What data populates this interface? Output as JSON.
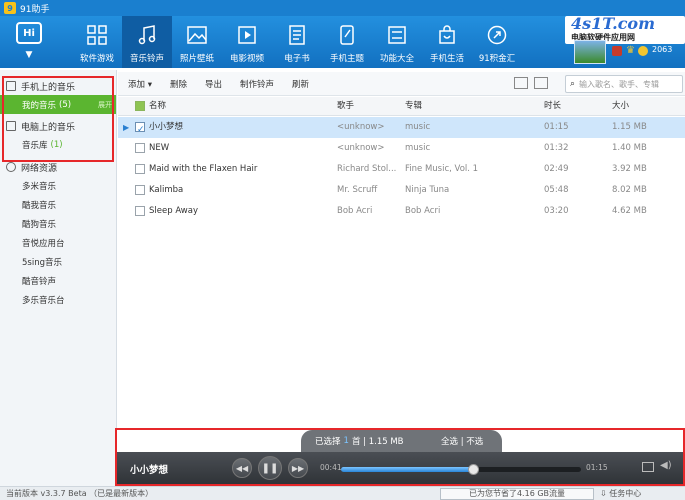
{
  "app": {
    "title": "91助手"
  },
  "header": {
    "hi_label": "Hi",
    "nav": [
      {
        "label": "软件游戏",
        "icon": "apps-grid-icon"
      },
      {
        "label": "音乐铃声",
        "icon": "music-note-icon",
        "active": true
      },
      {
        "label": "照片壁纸",
        "icon": "photo-icon"
      },
      {
        "label": "电影视频",
        "icon": "video-icon"
      },
      {
        "label": "电子书",
        "icon": "ebook-icon"
      },
      {
        "label": "手机主题",
        "icon": "phone-theme-icon"
      },
      {
        "label": "功能大全",
        "icon": "toolbox-icon"
      },
      {
        "label": "手机生活",
        "icon": "shopping-bag-icon"
      },
      {
        "label": "91积金汇",
        "icon": "coin-exchange-icon"
      }
    ],
    "brand": {
      "main": "4s1T.com",
      "sub": "电脑软硬件应用网"
    },
    "user": {
      "points": "2063"
    }
  },
  "sidebar": {
    "phone_music": "手机上的音乐",
    "my_music": "我的音乐",
    "my_music_count": "(5)",
    "expand_label": "展开",
    "pc_music": "电脑上的音乐",
    "library": "音乐库",
    "library_count": "(1)",
    "online": "网络资源",
    "online_items": [
      "多米音乐",
      "酷我音乐",
      "酷狗音乐",
      "音悦应用台",
      "5sing音乐",
      "酷音铃声",
      "多乐音乐台"
    ]
  },
  "toolbar": {
    "add": "添加",
    "delete": "删除",
    "export": "导出",
    "make_ringtone": "制作铃声",
    "refresh": "刷新",
    "search_placeholder": "输入歌名、歌手、专辑"
  },
  "table": {
    "headers": {
      "name": "名称",
      "artist": "歌手",
      "album": "专辑",
      "duration": "时长",
      "size": "大小"
    },
    "rows": [
      {
        "name": "小小梦想",
        "artist": "",
        "album": "",
        "duration": "01:15",
        "size": "1.15 MB",
        "selected": true
      },
      {
        "name": "NEW",
        "artist": "<unknow>",
        "album": "music",
        "duration": "01:32",
        "size": "1.40 MB"
      },
      {
        "name": "Maid with the Flaxen Hair",
        "artist": "Richard Stol...",
        "album": "Fine Music, Vol. 1",
        "duration": "02:49",
        "size": "3.92 MB"
      },
      {
        "name": "Kalimba",
        "artist": "Mr. Scruff",
        "album": "Ninja Tuna",
        "duration": "05:48",
        "size": "8.02 MB"
      },
      {
        "name": "Sleep Away",
        "artist": "Bob Acri",
        "album": "Bob Acri",
        "duration": "03:20",
        "size": "4.62 MB"
      }
    ],
    "row0_artist": "<unknow>",
    "row0_album": "music"
  },
  "player": {
    "selected_prefix": "已选择",
    "selected_count": "1",
    "selected_unit": "首 | 1.15 MB",
    "select_all": "全选 | 不选",
    "song": "小小梦想",
    "elapsed": "00:41",
    "total": "01:15",
    "progress": 0.55
  },
  "status": {
    "version": "当前版本 v3.3.7 Beta （已是最新版本）",
    "saved": "已为您节省了4.16 GB流量",
    "task_center": "任务中心"
  },
  "colors": {
    "header_blue": "#1a7fcf",
    "active_green": "#5bb530",
    "highlight_red": "#e6272a"
  }
}
